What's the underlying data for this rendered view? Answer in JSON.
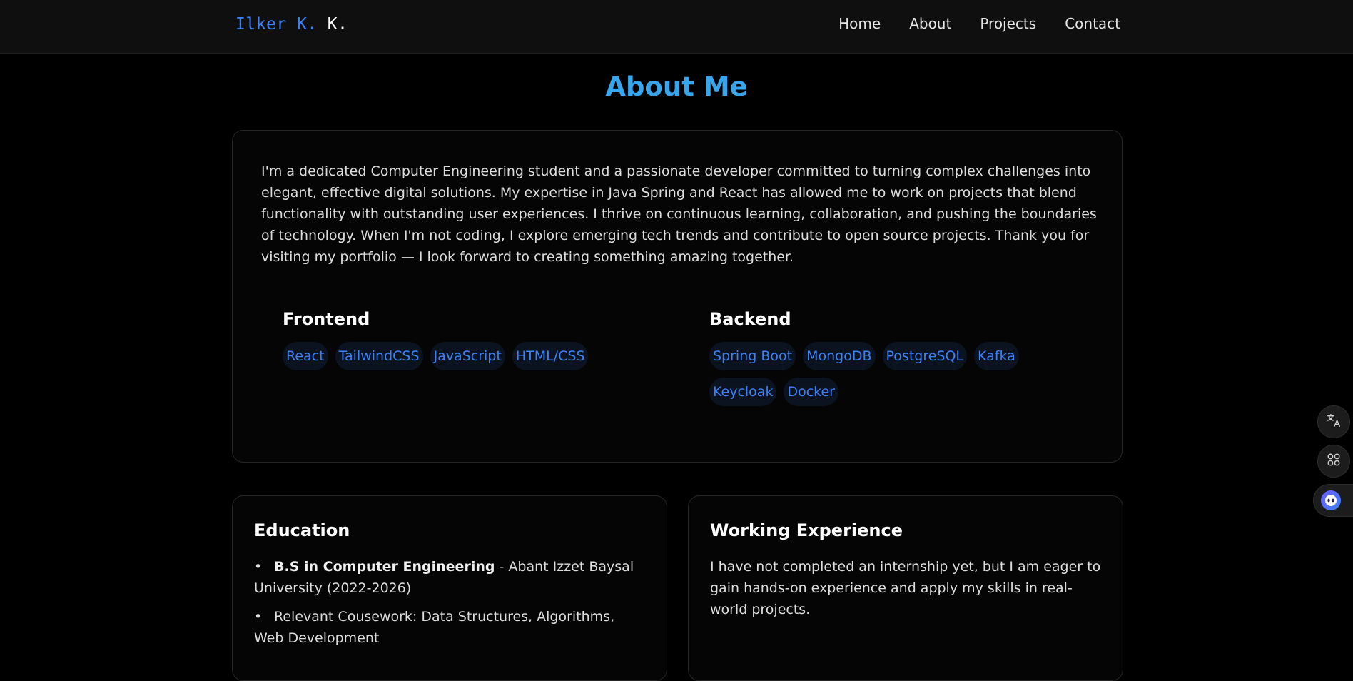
{
  "brand": {
    "part1": "Ilker K.",
    "part2": "K."
  },
  "nav": {
    "items": [
      {
        "label": "Home"
      },
      {
        "label": "About"
      },
      {
        "label": "Projects"
      },
      {
        "label": "Contact"
      }
    ]
  },
  "page": {
    "title": "About Me"
  },
  "about": {
    "text": "I'm a dedicated Computer Engineering student and a passionate developer committed to turning complex challenges into elegant, effective digital solutions. My expertise in Java Spring and React has allowed me to work on projects that blend functionality with outstanding user experiences. I thrive on continuous learning, collaboration, and pushing the boundaries of technology. When I'm not coding, I explore emerging tech trends and contribute to open source projects. Thank you for visiting my portfolio — I look forward to creating something amazing together."
  },
  "skills": {
    "frontend": {
      "title": "Frontend",
      "tags": [
        "React",
        "TailwindCSS",
        "JavaScript",
        "HTML/CSS"
      ]
    },
    "backend": {
      "title": "Backend",
      "tags": [
        "Spring Boot",
        "MongoDB",
        "PostgreSQL",
        "Kafka",
        "Keycloak",
        "Docker"
      ]
    }
  },
  "education": {
    "title": "Education",
    "items": [
      {
        "bold": "B.S in Computer Engineering",
        "text": " - Abant Izzet Baysal University (2022-2026)"
      },
      {
        "bold": "",
        "text": "Relevant Cousework: Data Structures, Algorithms, Web Development"
      }
    ]
  },
  "experience": {
    "title": "Working Experience",
    "text": "I have not completed an internship yet, but I am eager to gain hands-on experience and apply my skills in real-world projects."
  },
  "colors": {
    "accent_title": "#38a6ec",
    "tag_text": "#3b82f6",
    "tag_bg": "#0b1220",
    "background": "#000000"
  },
  "floating": {
    "icons": [
      "translate-icon",
      "apps-icon",
      "assistant-icon"
    ]
  }
}
